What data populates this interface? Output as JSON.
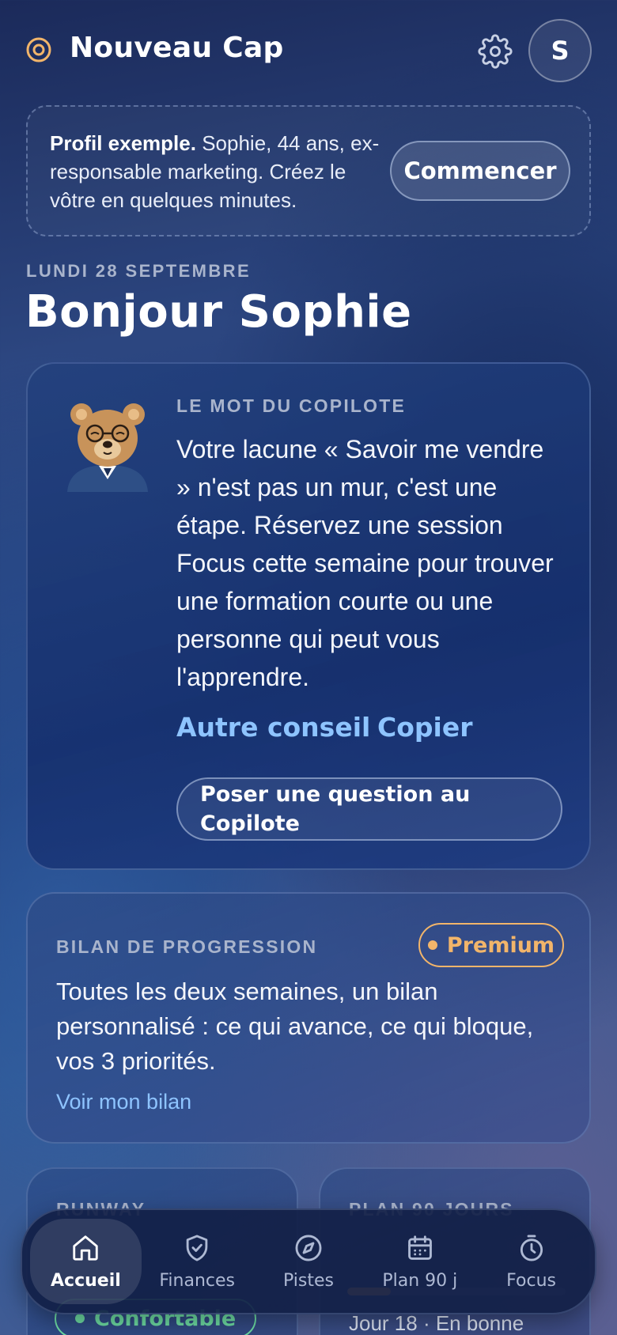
{
  "header": {
    "title": "Nouveau Cap",
    "avatar_initial": "S",
    "logo_icon": "target-icon",
    "settings_icon": "gear-icon"
  },
  "example_banner": {
    "bold": "Profil exemple.",
    "text": " Sophie, 44 ans, ex-responsable marketing. Créez le vôtre en quelques minutes.",
    "button": "Commencer"
  },
  "date_label": "LUNDI 28 SEPTEMBRE",
  "greeting": "Bonjour Sophie",
  "copilot": {
    "label": "LE MOT DU COPILOTE",
    "message": "Votre lacune « Savoir me vendre » n'est pas un mur, c'est une étape. Réservez une session Focus cette semaine pour trouver une formation courte ou une personne qui peut vous l'apprendre.",
    "another_tip": "Autre conseil",
    "copy": "Copier",
    "ask": "Poser une question au Copilote"
  },
  "progress": {
    "label": "BILAN DE PROGRESSION",
    "badge": "Premium",
    "text": "Toutes les deux semaines, un bilan personnalisé : ce qui avance, ce qui bloque, vos 3 priorités.",
    "link": "Voir mon bilan"
  },
  "runway": {
    "label": "RUNWAY",
    "status": "Confortable"
  },
  "plan": {
    "label": "PLAN 90 JOURS",
    "progress": 0.2,
    "sub": "Jour 18 · En bonne"
  },
  "nav": [
    {
      "label": "Accueil",
      "icon": "home-icon",
      "active": true
    },
    {
      "label": "Finances",
      "icon": "shield-check-icon",
      "active": false
    },
    {
      "label": "Pistes",
      "icon": "compass-icon",
      "active": false
    },
    {
      "label": "Plan 90 j",
      "icon": "calendar-icon",
      "active": false
    },
    {
      "label": "Focus",
      "icon": "timer-icon",
      "active": false
    }
  ],
  "colors": {
    "accent_link": "#8ec4ff",
    "premium": "#f2b56a",
    "status_ok": "#6fe0a6",
    "logo": "#f2b56a"
  }
}
